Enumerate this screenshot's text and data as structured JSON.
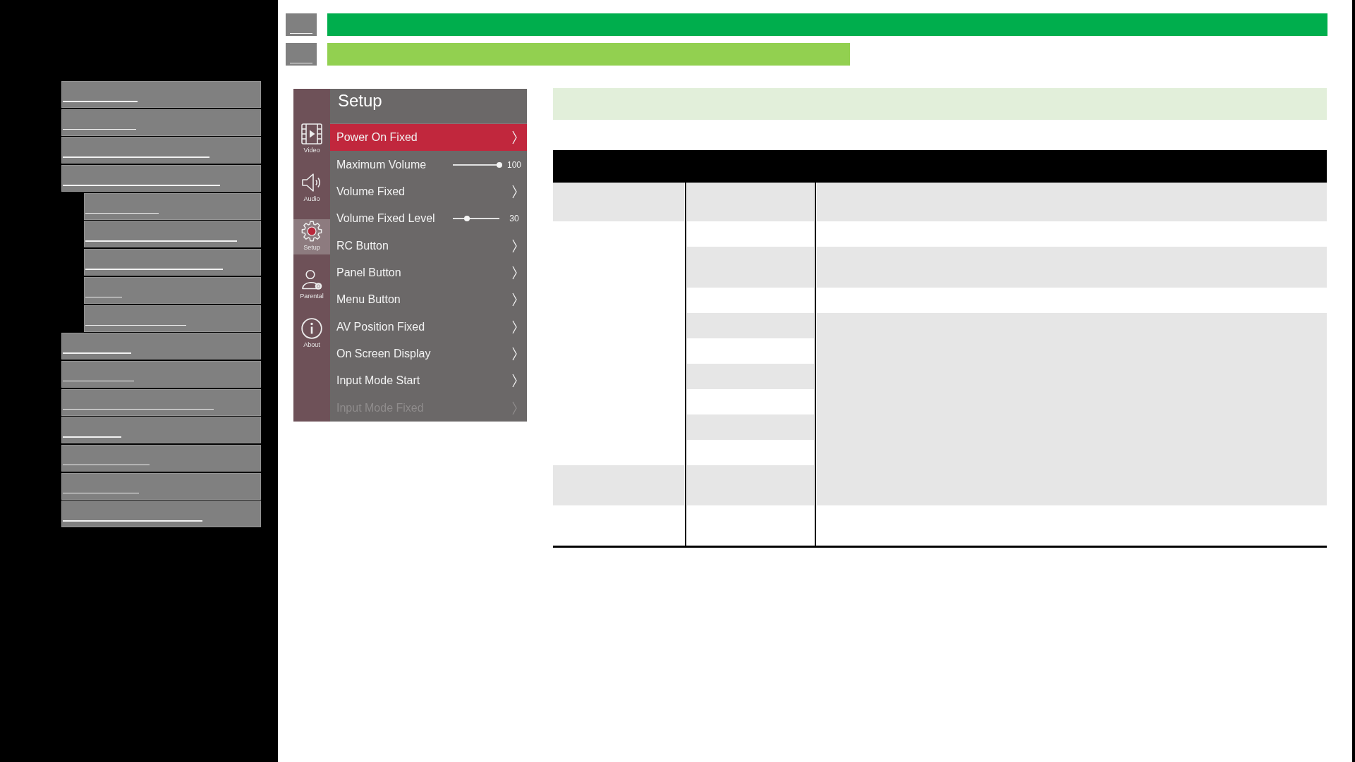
{
  "sidebar": {
    "items": [
      {
        "redacted": true
      },
      {
        "redacted": true
      },
      {
        "redacted": true
      },
      {
        "redacted": true,
        "children": [
          {
            "redacted": true
          },
          {
            "redacted": true
          },
          {
            "redacted": true
          },
          {
            "redacted": true
          },
          {
            "redacted": true
          }
        ]
      },
      {
        "redacted": true
      },
      {
        "redacted": true
      },
      {
        "redacted": true
      },
      {
        "redacted": true
      },
      {
        "redacted": true
      },
      {
        "redacted": true
      },
      {
        "redacted": true
      }
    ]
  },
  "section_headers": [
    {
      "marker_redacted": true,
      "color": "#00ae4d"
    },
    {
      "marker_redacted": true,
      "color": "#92d050"
    }
  ],
  "menu": {
    "title": "Setup",
    "categories": [
      {
        "label": "Video",
        "selected": false
      },
      {
        "label": "Audio",
        "selected": false
      },
      {
        "label": "Setup",
        "selected": true
      },
      {
        "label": "Parental",
        "selected": false
      },
      {
        "label": "About",
        "selected": false
      }
    ],
    "items": [
      {
        "kind": "submenu",
        "label": "Power On Fixed",
        "selected": true,
        "disabled": false
      },
      {
        "kind": "slider",
        "label": "Maximum Volume",
        "level": 1,
        "reading": "100",
        "selected": false,
        "disabled": false
      },
      {
        "kind": "submenu",
        "label": "Volume Fixed",
        "selected": false,
        "disabled": false
      },
      {
        "kind": "slider",
        "label": "Volume Fixed Level",
        "level": 0.3,
        "reading": "30",
        "selected": false,
        "disabled": false
      },
      {
        "kind": "submenu",
        "label": "RC Button",
        "selected": false,
        "disabled": false
      },
      {
        "kind": "submenu",
        "label": "Panel Button",
        "selected": false,
        "disabled": false
      },
      {
        "kind": "submenu",
        "label": "Menu Button",
        "selected": false,
        "disabled": false
      },
      {
        "kind": "submenu",
        "label": "AV Position Fixed",
        "selected": false,
        "disabled": false
      },
      {
        "kind": "submenu",
        "label": "On Screen Display",
        "selected": false,
        "disabled": false
      },
      {
        "kind": "submenu",
        "label": "Input Mode Start",
        "selected": false,
        "disabled": false
      },
      {
        "kind": "submenu",
        "label": "Input Mode Fixed",
        "selected": false,
        "disabled": true
      }
    ]
  },
  "table": {
    "columns": [
      {
        "cells": [
          {
            "shaded": true
          },
          {
            "shaded": false
          },
          {
            "shaded": true
          },
          {
            "shaded": false
          }
        ]
      },
      {
        "cells": [
          {
            "shaded": true
          },
          {
            "shaded": false
          },
          {
            "shaded": true
          },
          {
            "shaded": false
          },
          {
            "shaded": true
          },
          {
            "shaded": false
          },
          {
            "shaded": true
          },
          {
            "shaded": false
          },
          {
            "shaded": true
          },
          {
            "shaded": false
          },
          {
            "shaded": true
          },
          {
            "shaded": false
          }
        ]
      },
      {
        "cells": [
          {
            "shaded": true
          },
          {
            "shaded": false
          },
          {
            "shaded": true
          },
          {
            "shaded": false
          },
          {
            "shaded": true
          },
          {
            "shaded": false
          }
        ]
      }
    ]
  }
}
